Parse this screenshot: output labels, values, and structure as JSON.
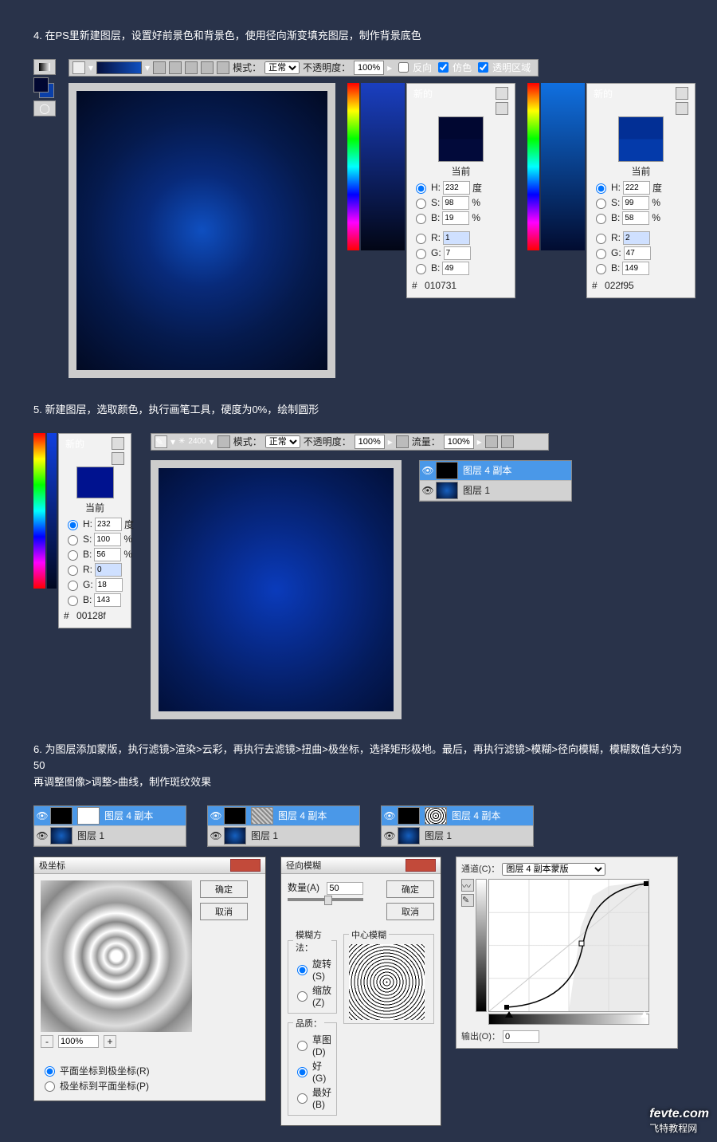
{
  "step4": {
    "text": "4. 在PS里新建图层，设置好前景色和背景色，使用径向渐变填充图层，制作背景底色",
    "optbar": {
      "mode_label": "模式：",
      "mode_value": "正常",
      "opacity_label": "不透明度：",
      "opacity_value": "100%",
      "cb_reverse": "反向",
      "cb_dither": "仿色",
      "cb_trans": "透明区域"
    },
    "pickerA": {
      "new": "新的",
      "current": "当前",
      "H": "232",
      "Hs": "度",
      "S": "98",
      "Ss": "%",
      "B": "19",
      "Bs": "%",
      "R": "1",
      "G": "7",
      "Bv": "49",
      "hex": "010731",
      "hash": "#"
    },
    "pickerB": {
      "new": "新的",
      "current": "当前",
      "H": "222",
      "Hs": "度",
      "S": "99",
      "Ss": "%",
      "B": "58",
      "Bs": "%",
      "R": "2",
      "G": "47",
      "Bv": "149",
      "hex": "022f95",
      "hash": "#"
    }
  },
  "step5": {
    "text": "5. 新建图层，选取颜色，执行画笔工具，硬度为0%，绘制圆形",
    "optbar": {
      "size": "2400",
      "mode_label": "模式：",
      "mode_value": "正常",
      "opacity_label": "不透明度：",
      "opacity_value": "100%",
      "flow_label": "流量：",
      "flow_value": "100%"
    },
    "picker": {
      "new": "新的",
      "current": "当前",
      "H": "232",
      "Hs": "度",
      "S": "100",
      "Ss": "%",
      "B": "56",
      "Bs": "%",
      "R": "0",
      "G": "18",
      "Bv": "143",
      "hex": "00128f",
      "hash": "#"
    },
    "layers": {
      "row1": "图层 4 副本",
      "row2": "图层 1"
    }
  },
  "step6": {
    "line1": "6. 为图层添加蒙版，执行滤镜>渲染>云彩，再执行去滤镜>扭曲>极坐标，选择矩形极地。最后，再执行滤镜>模糊>径向模糊，模糊数值大约为50",
    "line2": "再调整图像>调整>曲线，制作斑纹效果",
    "layersA": {
      "row1": "图层 4 副本",
      "row2": "图层 1"
    },
    "layersB": {
      "row1": "图层 4 副本",
      "row2": "图层 1"
    },
    "layersC": {
      "row1": "图层 4 副本",
      "row2": "图层 1"
    },
    "polar": {
      "title": "极坐标",
      "ok": "确定",
      "cancel": "取消",
      "zoom": "100%",
      "minus": "-",
      "plus": "+",
      "opt1": "平面坐标到极坐标(R)",
      "opt2": "极坐标到平面坐标(P)"
    },
    "radial": {
      "title": "径向模糊",
      "ok": "确定",
      "cancel": "取消",
      "amount_label": "数量(A)",
      "amount_value": "50",
      "method_legend": "模糊方法：",
      "center_legend": "中心模糊",
      "m1": "旋转(S)",
      "m2": "缩放(Z)",
      "quality_legend": "品质：",
      "q1": "草图(D)",
      "q2": "好(G)",
      "q3": "最好(B)"
    },
    "curves": {
      "channel_label": "通道(C)：",
      "channel_value": "图层 4 副本蒙版",
      "output_label": "输出(O)：",
      "output_value": "0"
    }
  },
  "watermark": {
    "main": "fevte.com",
    "sub": "飞特教程网"
  }
}
